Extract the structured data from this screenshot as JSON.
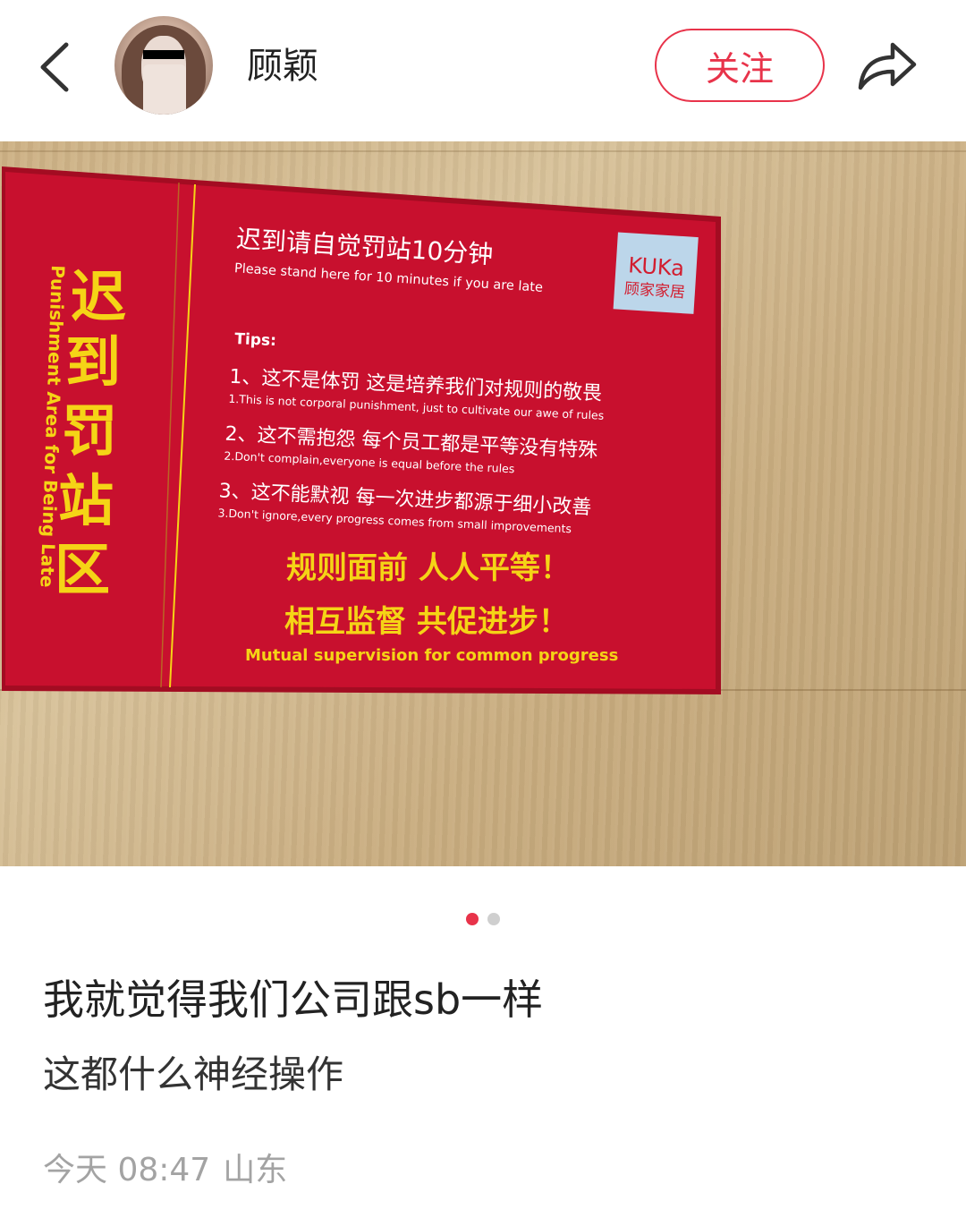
{
  "header": {
    "username": "顾颖",
    "follow_label": "关注",
    "back_icon": "chevron-left-icon",
    "share_icon": "share-arrow-icon"
  },
  "photo": {
    "sign": {
      "side_cn": [
        "迟",
        "到",
        "罚",
        "站",
        "区"
      ],
      "side_en": "Punishment Area for Being Late",
      "headline_cn": "迟到请自觉罚站10分钟",
      "headline_en": "Please stand here for 10 minutes if you are late",
      "brand_en": "KUKa",
      "brand_cn": "顾家家居",
      "tips_label": "Tips:",
      "tips": [
        {
          "cn": "1、这不是体罚 这是培养我们对规则的敬畏",
          "en": "1.This is not corporal punishment, just to cultivate our awe of rules"
        },
        {
          "cn": "2、这不需抱怨 每个员工都是平等没有特殊",
          "en": "2.Don't complain,everyone is equal before the rules"
        },
        {
          "cn": "3、这不能默视 每一次进步都源于细小改善",
          "en": "3.Don't ignore,every progress comes from small improvements"
        }
      ],
      "slogan_1": "规则面前  人人平等！",
      "slogan_2": "相互监督  共促进步！",
      "slogan_en": "Mutual supervision for common progress"
    },
    "colors": {
      "sign_red": "#c8102e",
      "sign_gold": "#f5d416",
      "accent": "#e8334a"
    }
  },
  "pager": {
    "total": 2,
    "active": 1
  },
  "post": {
    "title": "我就觉得我们公司跟sb一样",
    "body": "这都什么神经操作",
    "time": "今天 08:47",
    "location": "山东"
  }
}
